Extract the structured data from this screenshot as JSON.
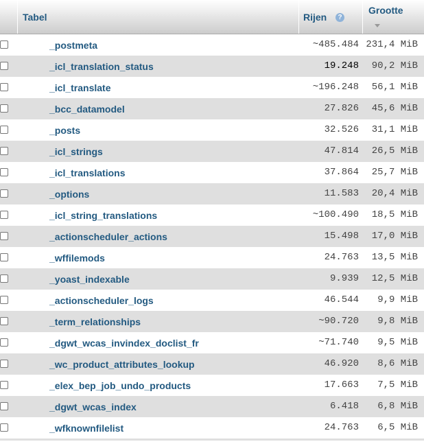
{
  "header": {
    "table_label": "Tabel",
    "rows_label": "Rijen",
    "rows_help_icon": "help-icon",
    "size_label": "Grootte",
    "size_sort_icon": "sort-desc-icon"
  },
  "rows": [
    {
      "name": "_postmeta",
      "count": "~485.484",
      "size": "231,4 MiB"
    },
    {
      "name": "_icl_translation_status",
      "count": "19.248",
      "size": "90,2 MiB"
    },
    {
      "name": "_icl_translate",
      "count": "~196.248",
      "size": "56,1 MiB"
    },
    {
      "name": "_bcc_datamodel",
      "count": "27.826",
      "size": "45,6 MiB"
    },
    {
      "name": "_posts",
      "count": "32.526",
      "size": "31,1 MiB"
    },
    {
      "name": "_icl_strings",
      "count": "47.814",
      "size": "26,5 MiB"
    },
    {
      "name": "_icl_translations",
      "count": "37.864",
      "size": "25,7 MiB"
    },
    {
      "name": "_options",
      "count": "11.583",
      "size": "20,4 MiB"
    },
    {
      "name": "_icl_string_translations",
      "count": "~100.490",
      "size": "18,5 MiB"
    },
    {
      "name": "_actionscheduler_actions",
      "count": "15.498",
      "size": "17,0 MiB"
    },
    {
      "name": "_wffilemods",
      "count": "24.763",
      "size": "13,5 MiB"
    },
    {
      "name": "_yoast_indexable",
      "count": "9.939",
      "size": "12,5 MiB"
    },
    {
      "name": "_actionscheduler_logs",
      "count": "46.544",
      "size": "9,9 MiB"
    },
    {
      "name": "_term_relationships",
      "count": "~90.720",
      "size": "9,8 MiB"
    },
    {
      "name": "_dgwt_wcas_invindex_doclist_fr",
      "count": "~71.740",
      "size": "9,5 MiB"
    },
    {
      "name": "_wc_product_attributes_lookup",
      "count": "46.920",
      "size": "8,6 MiB"
    },
    {
      "name": "_elex_bep_job_undo_products",
      "count": "17.663",
      "size": "7,5 MiB"
    },
    {
      "name": "_dgwt_wcas_index",
      "count": "6.418",
      "size": "6,8 MiB"
    },
    {
      "name": "_wfknownfilelist",
      "count": "24.763",
      "size": "6,5 MiB"
    }
  ]
}
